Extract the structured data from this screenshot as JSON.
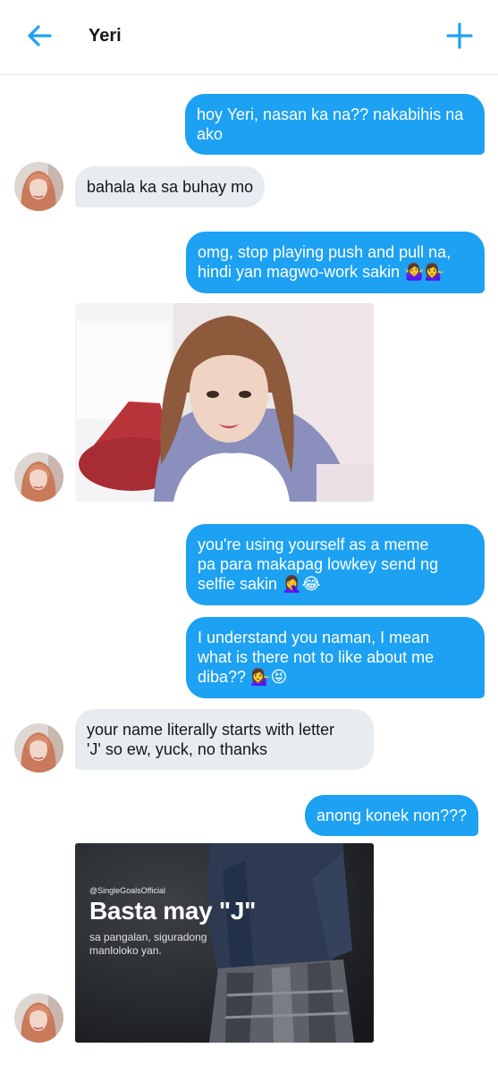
{
  "header": {
    "title": "Yeri",
    "back_icon": "arrow-left-icon",
    "new_icon": "plus-icon",
    "accent": "#1da1f2"
  },
  "messages": {
    "m1": "hoy Yeri, nasan ka na?? nakabihis na ako",
    "m2": "bahala ka sa buhay mo",
    "m3_line1": "omg, stop playing push and pull na,",
    "m3_line2": "hindi yan magwo-work sakin",
    "m3_emoji": "🤷‍♀️💁‍♀️",
    "m4_line1": "you're using yourself as a meme",
    "m4_line2": "pa para makapag lowkey send ng",
    "m4_line3": "selfie sakin",
    "m4_emoji": "🤦‍♀️😂",
    "m5_line1": "I understand you naman, I mean",
    "m5_line2": "what is there not to like about me",
    "m5_line3": "diba??",
    "m5_emoji": "💁‍♀️😝",
    "m6_line1": "your name literally starts with letter",
    "m6_line2": "'J' so ew, yuck, no thanks",
    "m7": "anong konek non???"
  },
  "meme": {
    "handle": "@SingleGoalsOfficial",
    "title": "Basta may \"J\"",
    "subtitle": "sa pangalan, siguradong manloloko yan."
  },
  "colors": {
    "outgoing_bubble": "#1da1f2",
    "incoming_bubble": "#e6ecf0"
  }
}
